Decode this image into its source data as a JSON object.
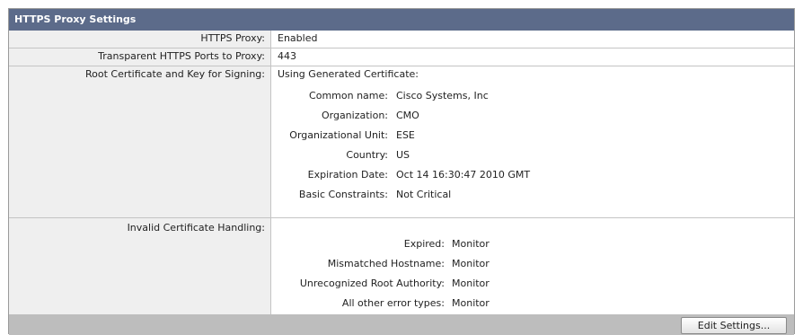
{
  "panel": {
    "title": "HTTPS Proxy Settings"
  },
  "rows": {
    "https_proxy": {
      "label": "HTTPS Proxy:",
      "value": "Enabled"
    },
    "ports": {
      "label": "Transparent HTTPS Ports to Proxy:",
      "value": "443"
    },
    "root_cert": {
      "label": "Root Certificate and Key for Signing:",
      "value": "Using Generated Certificate:",
      "details": [
        {
          "key": "Common name:",
          "value": "Cisco Systems, Inc"
        },
        {
          "key": "Organization:",
          "value": "CMO"
        },
        {
          "key": "Organizational Unit:",
          "value": "ESE"
        },
        {
          "key": "Country:",
          "value": "US"
        },
        {
          "key": "Expiration Date:",
          "value": "Oct 14 16:30:47 2010 GMT"
        },
        {
          "key": "Basic Constraints:",
          "value": "Not Critical"
        }
      ]
    },
    "invalid_cert": {
      "label": "Invalid Certificate Handling:",
      "details": [
        {
          "key": "Expired:",
          "value": "Monitor"
        },
        {
          "key": "Mismatched Hostname:",
          "value": "Monitor"
        },
        {
          "key": "Unrecognized Root Authority:",
          "value": "Monitor"
        },
        {
          "key": "All other error types:",
          "value": "Monitor"
        }
      ]
    }
  },
  "footer": {
    "edit_button_label": "Edit Settings..."
  },
  "colors": {
    "header_bg": "#5c6b8a",
    "label_bg": "#efefef",
    "footer_bg": "#bdbdbd"
  }
}
